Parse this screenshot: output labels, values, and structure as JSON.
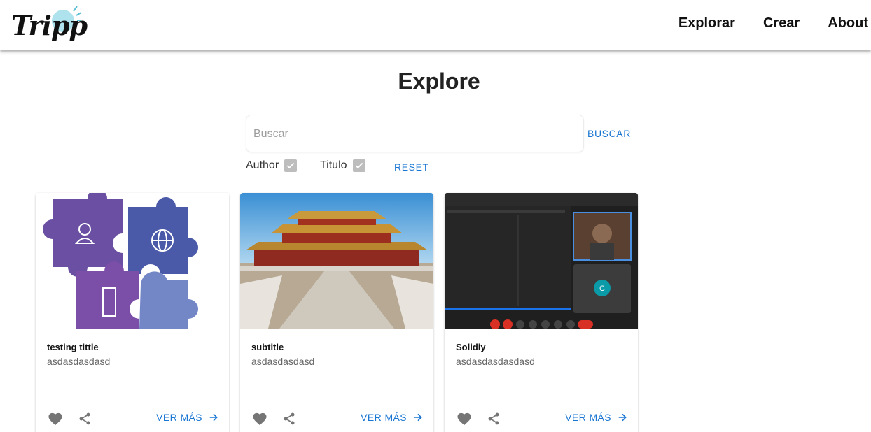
{
  "header": {
    "logo_text": "Tripp",
    "nav": [
      {
        "label": "Explorar"
      },
      {
        "label": "Crear"
      },
      {
        "label": "About"
      }
    ]
  },
  "page": {
    "title": "Explore"
  },
  "search": {
    "placeholder": "Buscar",
    "value": "",
    "button_label": "BUSCAR",
    "filters": [
      {
        "label": "Author",
        "checked": true
      },
      {
        "label": "Titulo",
        "checked": true
      }
    ],
    "reset_label": "RESET"
  },
  "cards": [
    {
      "title": "testing tittle",
      "subtitle": "asdasdasdasd",
      "cta": "VER MÁS",
      "image": "puzzle-illustration"
    },
    {
      "title": "subtitle",
      "subtitle": "asdasdasdasd",
      "cta": "VER MÁS",
      "image": "forbidden-city-photo"
    },
    {
      "title": "Solidiy",
      "subtitle": "asdasdasdasdasd",
      "cta": "VER MÁS",
      "image": "video-call-screenshot"
    }
  ],
  "colors": {
    "accent": "#1976d2",
    "icon": "#757575",
    "checkbox": "#bdbdbd"
  }
}
